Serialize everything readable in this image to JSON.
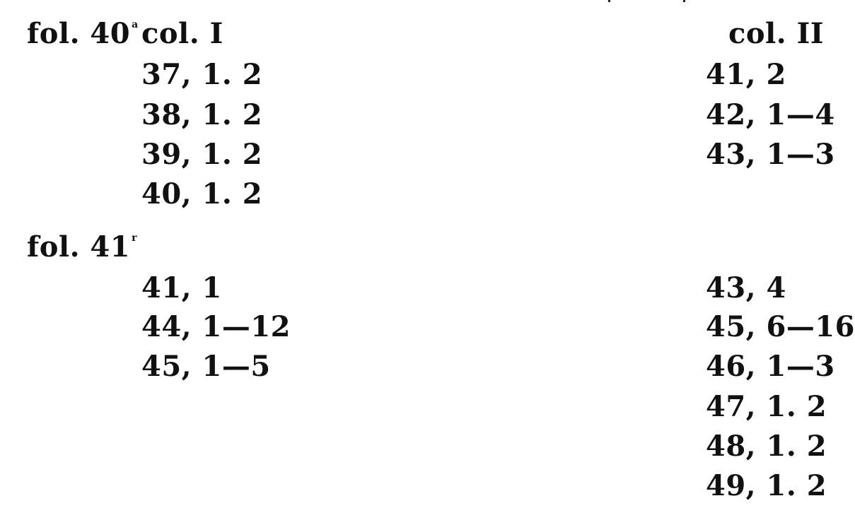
{
  "folio_40": {
    "label": "fol. 40",
    "side": "a",
    "col_I_label": "col. I",
    "col_II_label": "col. II",
    "col_I_entries": [
      "37, 1. 2",
      "38, 1. 2",
      "39, 1. 2",
      "40, 1. 2"
    ],
    "col_II_entries": [
      "41, 2",
      "42, 1—4",
      "43, 1—3"
    ]
  },
  "folio_41": {
    "label": "fol. 41",
    "side": "r",
    "col_I_entries": [
      "41, 1",
      "44, 1—12",
      "45, 1—5"
    ],
    "col_II_entries": [
      "43, 4",
      "45, 6—16",
      "46, 1—3",
      "47, 1. 2",
      "48, 1. 2",
      "49, 1. 2"
    ]
  }
}
